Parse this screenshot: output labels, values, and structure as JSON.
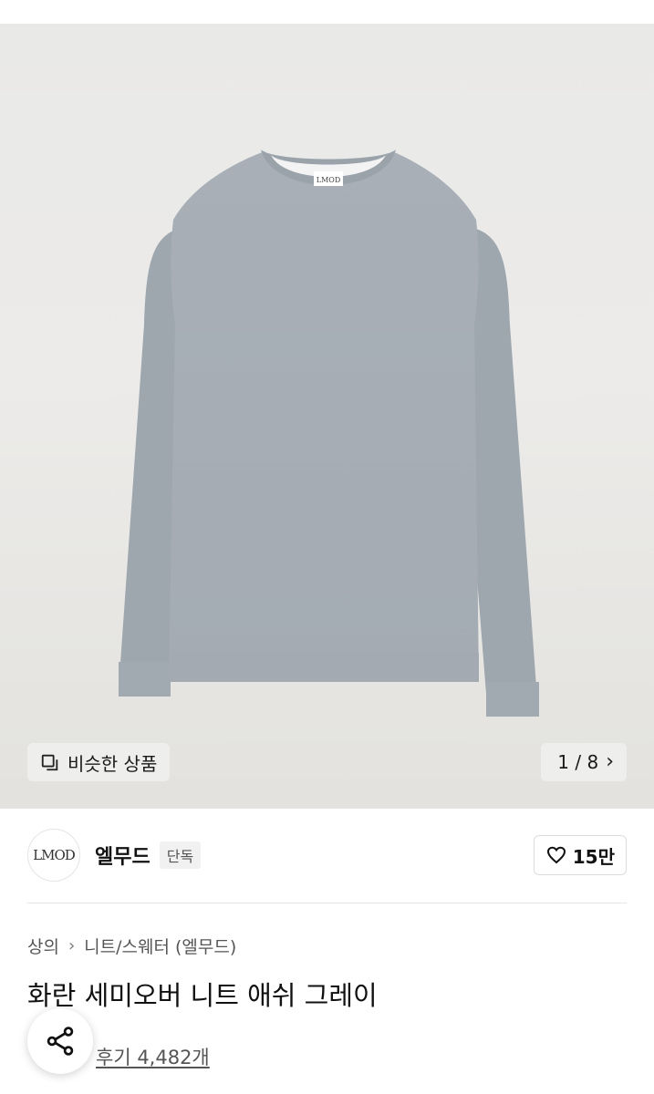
{
  "gallery": {
    "similar_label": "비슷한 상품",
    "pager": "1 / 8",
    "product_logo": "LMOD"
  },
  "brand": {
    "logo_text": "LMOD",
    "name": "엘무드",
    "badge": "단독",
    "likes": "15만"
  },
  "breadcrumb": {
    "items": [
      "상의",
      "니트/스웨터 (엘무드)"
    ]
  },
  "product": {
    "title": "화란 세미오버 니트 애쉬 그레이",
    "reviews": "후기 4,482개"
  },
  "icons": {
    "similar": "similar-products-icon",
    "pager_next": "chevron-right-icon",
    "like": "heart-outline-icon",
    "share": "share-icon"
  },
  "colors": {
    "sweater": "#a9b0b7",
    "background": "#ebeae8"
  }
}
